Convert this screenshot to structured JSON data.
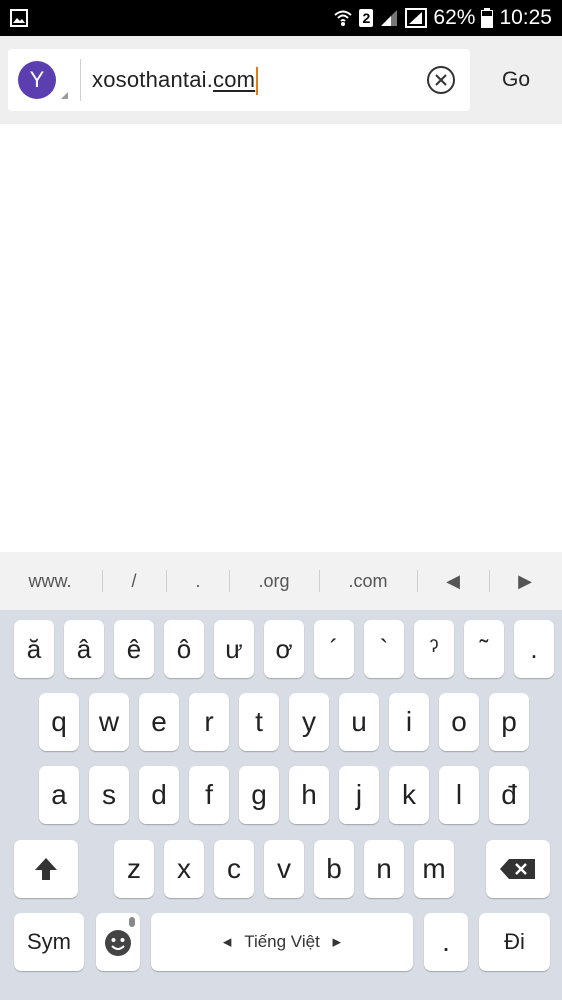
{
  "status_bar": {
    "sim_badge": "2",
    "battery": "62%",
    "time": "10:25",
    "icons": [
      "gallery-icon",
      "wifi-icon",
      "signal-icon",
      "signal-icon",
      "battery-icon"
    ]
  },
  "address_bar": {
    "avatar_letter": "Y",
    "url_value_plain": "xosothantai.",
    "url_value_underlined": "com",
    "go_label": "Go",
    "clear_icon": "clear-circle-icon"
  },
  "suggestions": [
    "www.",
    "/",
    ".",
    ".org",
    ".com",
    "◀",
    "▶"
  ],
  "keyboard": {
    "row_diacritics": [
      "ă",
      "â",
      "ê",
      "ô",
      "ư",
      "ơ",
      "´",
      "`",
      "ˀ",
      "˜",
      "."
    ],
    "row1": [
      "q",
      "w",
      "e",
      "r",
      "t",
      "y",
      "u",
      "i",
      "o",
      "p"
    ],
    "row2": [
      "a",
      "s",
      "d",
      "f",
      "g",
      "h",
      "j",
      "k",
      "l",
      "đ"
    ],
    "row3": [
      "z",
      "x",
      "c",
      "v",
      "b",
      "n",
      "m"
    ],
    "sym_label": "Sym",
    "space_label": "Tiếng Việt",
    "period_label": ".",
    "enter_label": "Đi"
  },
  "colors": {
    "avatar": "#5b3fb1",
    "caret": "#e07a1b",
    "keyboard_bg": "#d8dce4"
  }
}
